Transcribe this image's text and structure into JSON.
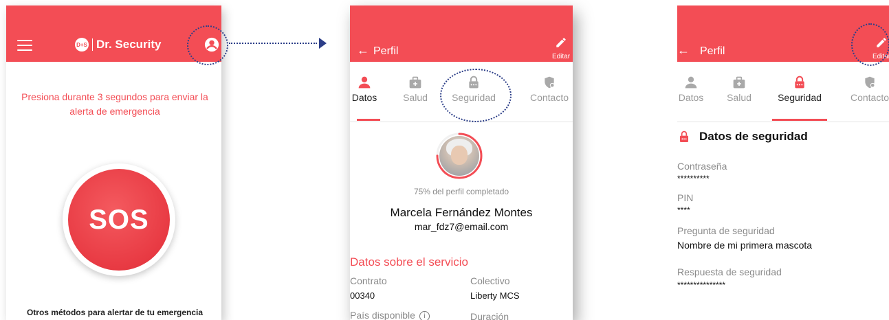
{
  "colors": {
    "brand": "#f34d55",
    "annotation": "#2c3e88"
  },
  "home": {
    "menu_icon": "hamburger-icon",
    "logo_badge": "D+S",
    "app_title": "Dr. Security",
    "profile_icon": "user-circle-icon",
    "alert_instruction": "Presiona durante 3 segundos para enviar la alerta de emergencia",
    "sos_label": "SOS",
    "other_methods": "Otros métodos para alertar de tu emergencia"
  },
  "profile": {
    "back_icon": "arrow-left-icon",
    "title": "Perfil",
    "edit_label": "Editar",
    "tabs": [
      {
        "label": "Datos",
        "icon": "person-icon",
        "active": true
      },
      {
        "label": "Salud",
        "icon": "medical-kit-icon",
        "active": false
      },
      {
        "label": "Seguridad",
        "icon": "lock-icon",
        "active": false
      },
      {
        "label": "Contacto",
        "icon": "shield-icon",
        "active": false
      }
    ],
    "profile_completion_percent": 75,
    "completion_text": "75% del perfil completado",
    "name": "Marcela Fernández Montes",
    "email": "mar_fdz7@email.com",
    "service_section_title": "Datos sobre el servicio",
    "fields": [
      {
        "label": "Contrato",
        "value": "00340"
      },
      {
        "label": "Colectivo",
        "value": "Liberty MCS"
      },
      {
        "label": "País disponible",
        "value": ""
      },
      {
        "label": "Duración",
        "value": ""
      }
    ],
    "info_icon": "info-icon"
  },
  "security": {
    "title": "Perfil",
    "edit_label": "Editar",
    "tabs": [
      {
        "label": "Datos",
        "active": false
      },
      {
        "label": "Salud",
        "active": false
      },
      {
        "label": "Seguridad",
        "active": true
      },
      {
        "label": "Contacto",
        "active": false
      }
    ],
    "section_title": "Datos de seguridad",
    "fields": [
      {
        "label": "Contraseña",
        "value": "**********"
      },
      {
        "label": "PIN",
        "value": "****"
      },
      {
        "label": "Pregunta de seguridad",
        "value": "Nombre de mi primera mascota"
      },
      {
        "label": "Respuesta de seguridad",
        "value": "***************"
      }
    ]
  }
}
